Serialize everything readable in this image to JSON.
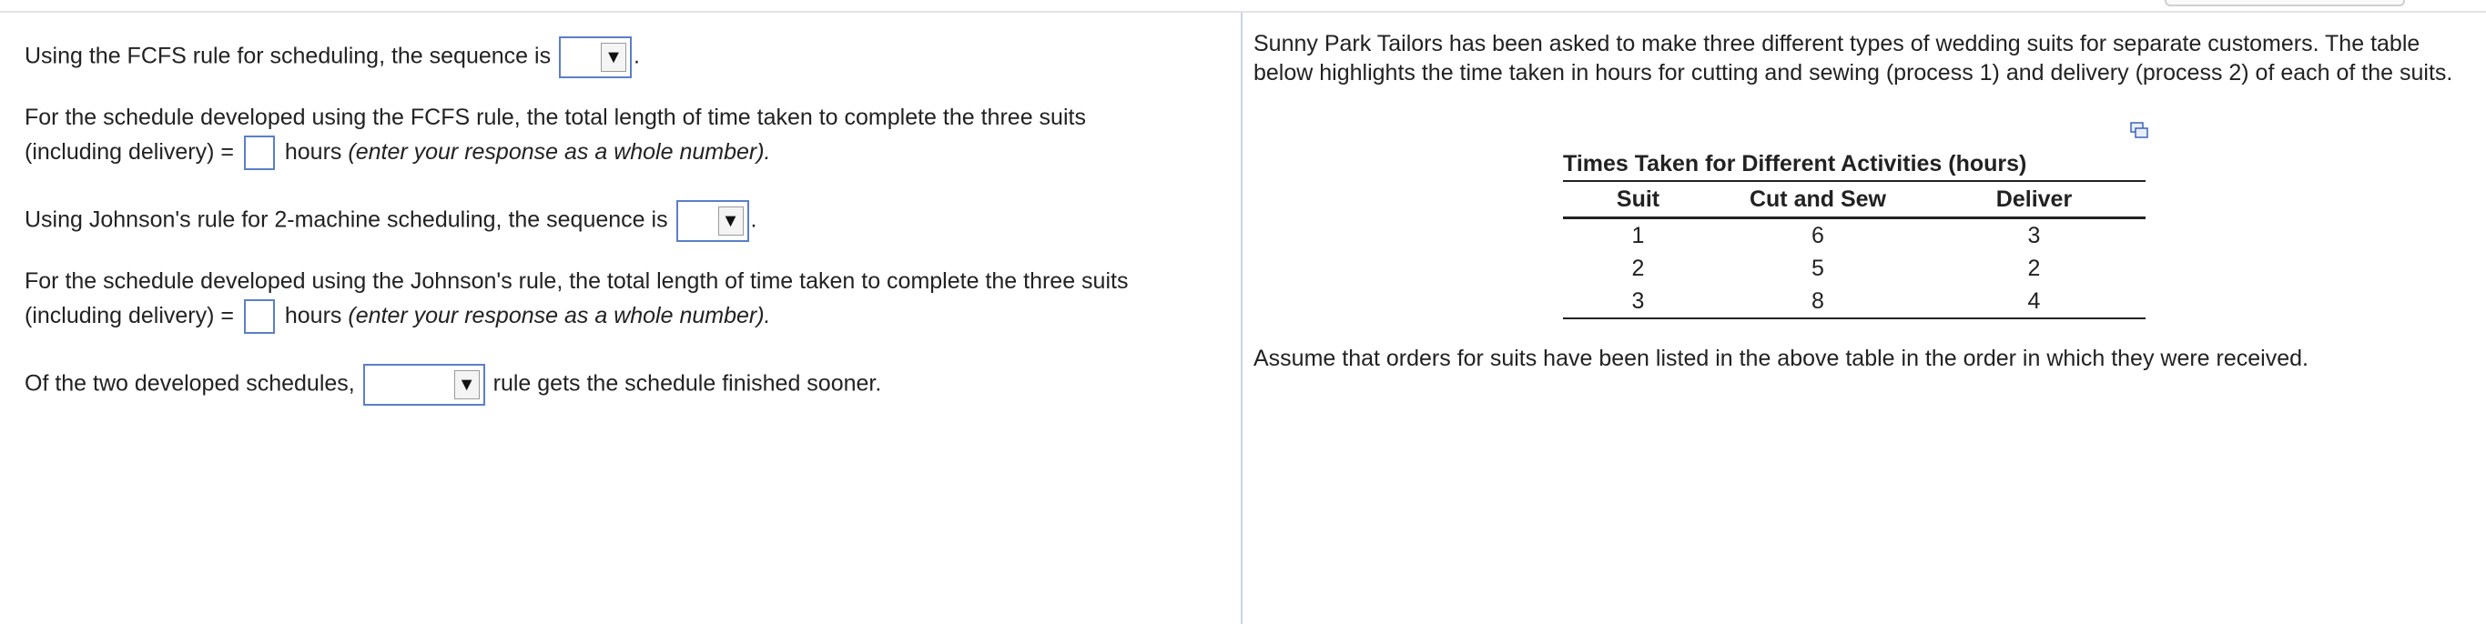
{
  "questions": {
    "q1": {
      "prefix": "Using the FCFS rule for scheduling, the sequence is",
      "suffix": ".",
      "selected": ""
    },
    "q2": {
      "line1": "For the schedule developed using the FCFS rule, the total length of time taken to complete the three suits",
      "prefix": "(including delivery) =",
      "unit": "hours",
      "hint": "(enter your response as a whole number).",
      "value": ""
    },
    "q3": {
      "prefix": "Using Johnson's rule for 2-machine scheduling, the sequence is",
      "suffix": ".",
      "selected": ""
    },
    "q4": {
      "line1": "For the schedule developed using the Johnson's rule, the total length of time taken to complete the three suits",
      "prefix": "(including delivery) =",
      "unit": "hours",
      "hint": "(enter your response as a whole number).",
      "value": ""
    },
    "q5": {
      "prefix": "Of the two developed schedules,",
      "suffix": "rule gets the schedule finished sooner.",
      "selected": ""
    }
  },
  "problem": {
    "intro": "Sunny Park Tailors has been asked to make three different types of wedding suits for separate customers. The table below highlights the time taken in hours for cutting and sewing (process 1) and delivery (process 2) of each of the suits.",
    "table": {
      "title": "Times Taken for Different Activities (hours)",
      "headers": [
        "Suit",
        "Cut and Sew",
        "Deliver"
      ],
      "rows": [
        [
          "1",
          "6",
          "3"
        ],
        [
          "2",
          "5",
          "2"
        ],
        [
          "3",
          "8",
          "4"
        ]
      ]
    },
    "outro": "Assume that orders for suits have been listed in the above table in the order in which they were received."
  },
  "icons": {
    "dropdown_arrow": "▼",
    "popout": "popout-icon"
  },
  "colors": {
    "input_border": "#5a7fc8",
    "divider": "#c8d3e6"
  }
}
